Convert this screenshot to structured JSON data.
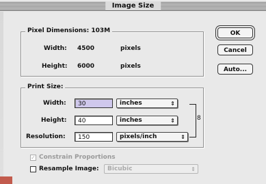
{
  "window": {
    "title": "Image Size"
  },
  "pixel_dimensions": {
    "legend": "Pixel Dimensions: 103M",
    "width_label": "Width:",
    "width_value": "4500",
    "width_unit": "pixels",
    "height_label": "Height:",
    "height_value": "6000",
    "height_unit": "pixels"
  },
  "print_size": {
    "legend": "Print Size:",
    "width_label": "Width:",
    "width_value": "30",
    "width_unit": "inches",
    "height_label": "Height:",
    "height_value": "40",
    "height_unit": "inches",
    "resolution_label": "Resolution:",
    "resolution_value": "150",
    "resolution_unit": "pixels/inch"
  },
  "options": {
    "constrain_label": "Constrain Proportions",
    "constrain_checked": true,
    "resample_label": "Resample Image:",
    "resample_checked": false,
    "resample_method": "Bicubic"
  },
  "buttons": {
    "ok": "OK",
    "cancel": "Cancel",
    "auto": "Auto..."
  },
  "icons": {
    "select_arrows": "⇕",
    "check": "✓",
    "link": "8"
  },
  "colors": {
    "active_field": "#cfc8ec",
    "background": "#e9e9e9"
  }
}
